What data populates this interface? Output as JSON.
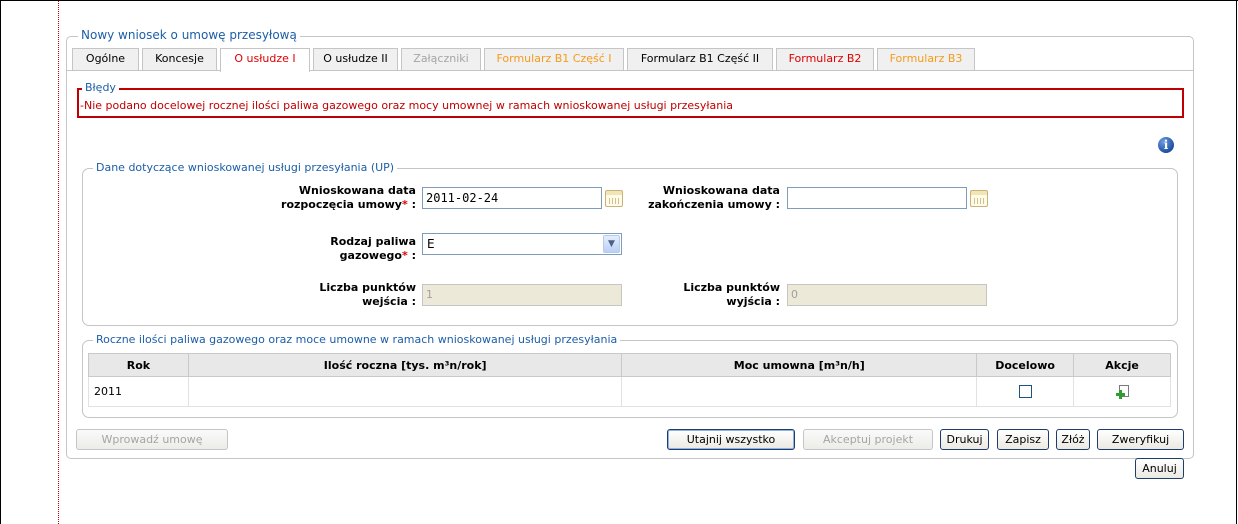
{
  "form": {
    "title": "Nowy wniosek o umowę przesyłową"
  },
  "tabs": [
    {
      "label": "Ogólne",
      "color": "#000000",
      "active": false
    },
    {
      "label": "Koncesje",
      "color": "#000000",
      "active": false
    },
    {
      "label": "O usłudze I",
      "color": "#e00000",
      "active": true
    },
    {
      "label": "O usłudze II",
      "color": "#000000",
      "active": false
    },
    {
      "label": "Załączniki",
      "color": "#a5a5a5",
      "active": false
    },
    {
      "label": "Formularz B1 Część I",
      "color": "#f59b1a",
      "active": false
    },
    {
      "label": "Formularz B1 Część II",
      "color": "#000000",
      "active": false
    },
    {
      "label": "Formularz B2",
      "color": "#e00000",
      "active": false
    },
    {
      "label": "Formularz B3",
      "color": "#f59b1a",
      "active": false
    }
  ],
  "errors": {
    "legend": "Błędy",
    "message": "-Nie podano docelowej rocznej ilości paliwa gazowego oraz mocy umownej w ramach wnioskowanej usługi przesyłania"
  },
  "info_icon": "info-icon",
  "service": {
    "legend": "Dane dotyczące wnioskowanej usługi przesyłania (UP)",
    "start_label_1": "Wnioskowana data",
    "start_label_2": "rozpoczęcia umowy",
    "start_value": "2011-02-24",
    "end_label_1": "Wnioskowana data",
    "end_label_2": "zakończenia umowy :",
    "end_value": "",
    "fuel_label_1": "Rodzaj paliwa",
    "fuel_label_2": "gazowego",
    "fuel_value": "E",
    "entry_label_1": "Liczba punktów",
    "entry_label_2": "wejścia :",
    "entry_value": "1",
    "exit_label_1": "Liczba punktów",
    "exit_label_2": "wyjścia :",
    "exit_value": "0",
    "required_mark": "*",
    "colon": ":"
  },
  "annual": {
    "legend": "Roczne ilości paliwa gazowego oraz moce umowne w ramach wnioskowanej usługi przesyłania",
    "columns": [
      "Rok",
      "Ilość roczna [tys. m³n/rok]",
      "Moc umowna [m³n/h]",
      "Docelowo",
      "Akcje"
    ],
    "rows": [
      {
        "year": "2011",
        "quantity": "",
        "power": "",
        "target": false
      }
    ]
  },
  "buttons": {
    "enter_contract": "Wprowadź umowę",
    "reveal_all": "Utajnij wszystko",
    "accept_project": "Akceptuj projekt",
    "print": "Drukuj",
    "save": "Zapisz",
    "submit": "Złóż",
    "verify": "Zweryfikuj",
    "cancel": "Anuluj"
  }
}
